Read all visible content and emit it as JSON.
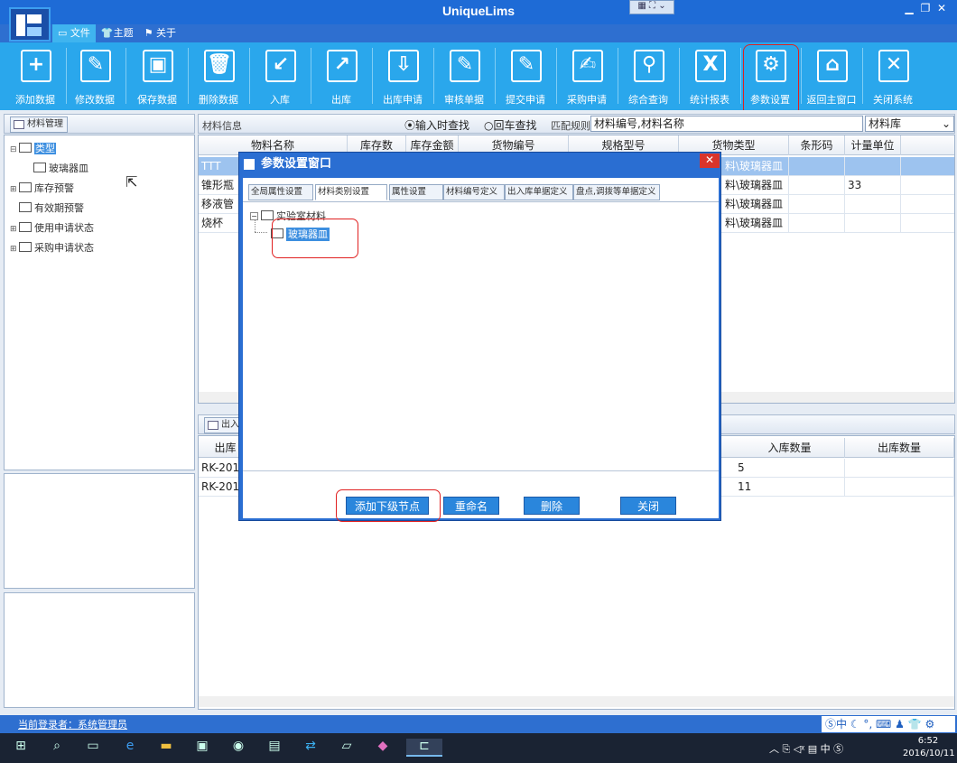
{
  "app": {
    "title": "UniqueLims"
  },
  "menu": [
    "文件",
    "主题",
    "关于"
  ],
  "toolbar": [
    {
      "label": "添加数据",
      "icon": "add-document-icon"
    },
    {
      "label": "修改数据",
      "icon": "edit-document-icon"
    },
    {
      "label": "保存数据",
      "icon": "save-icon"
    },
    {
      "label": "删除数据",
      "icon": "trash-icon"
    },
    {
      "label": "入库",
      "icon": "import-icon"
    },
    {
      "label": "出库",
      "icon": "export-icon"
    },
    {
      "label": "出库申请",
      "icon": "download-doc-icon"
    },
    {
      "label": "审核单据",
      "icon": "pen-icon"
    },
    {
      "label": "提交申请",
      "icon": "submit-doc-icon"
    },
    {
      "label": "采购申请",
      "icon": "purchase-icon"
    },
    {
      "label": "综合查询",
      "icon": "search-icon"
    },
    {
      "label": "统计报表",
      "icon": "excel-icon"
    },
    {
      "label": "参数设置",
      "icon": "gear-icon"
    },
    {
      "label": "返回主窗口",
      "icon": "home-icon"
    },
    {
      "label": "关闭系统",
      "icon": "close-x-icon"
    }
  ],
  "left_panel": {
    "tab": "材料管理",
    "tree": [
      {
        "label": "类型",
        "level": 0,
        "expander": "⊟",
        "selected": true
      },
      {
        "label": "玻璃器皿",
        "level": 1
      },
      {
        "label": "库存预警",
        "level": 0,
        "expander": "⊞"
      },
      {
        "label": "有效期预警",
        "level": 0,
        "expander": ""
      },
      {
        "label": "使用申请状态",
        "level": 0,
        "expander": "⊞"
      },
      {
        "label": "采购申请状态",
        "level": 0,
        "expander": "⊞"
      }
    ]
  },
  "material_info": {
    "title": "材料信息",
    "radio_live": "输入时查找",
    "radio_enter": "回车查找",
    "match_rule_label": "匹配规则",
    "search_value": "材料编号,材料名称",
    "library_select": "材料库",
    "columns": [
      "物料名称",
      "库存数",
      "库存金额",
      "货物编号",
      "规格型号",
      "货物类型",
      "条形码",
      "计量单位"
    ],
    "rows": [
      {
        "name": "TTT",
        "type": "料\\玻璃器皿",
        "barcode": "",
        "unit": "",
        "selected": true
      },
      {
        "name": "锥形瓶",
        "type": "料\\玻璃器皿",
        "barcode": "",
        "unit": "33"
      },
      {
        "name": "移液管",
        "type": "料\\玻璃器皿",
        "barcode": "",
        "unit": ""
      },
      {
        "name": "烧杯",
        "type": "料\\玻璃器皿",
        "barcode": "",
        "unit": ""
      }
    ]
  },
  "inout": {
    "tab": "出入",
    "columns": [
      "出库",
      "入库数量",
      "出库数量"
    ],
    "rows": [
      {
        "code": "RK-201",
        "in_qty": "5",
        "out_qty": ""
      },
      {
        "code": "RK-201",
        "in_qty": "11",
        "out_qty": ""
      }
    ]
  },
  "dialog": {
    "title": "参数设置窗口",
    "tabs": [
      "全局属性设置",
      "材料类别设置",
      "属性设置",
      "材料编号定义",
      "出入库单据定义",
      "盘点,调拨等单据定义"
    ],
    "active_tab": 1,
    "tree_root": "实验室材料",
    "tree_child": "玻璃器皿",
    "buttons": {
      "add_child": "添加下级节点",
      "rename": "重命名",
      "delete": "删除",
      "close": "关闭"
    }
  },
  "status": {
    "login_text": "当前登录者：系统管理员"
  },
  "taskbar": {
    "time": "6:52",
    "date": "2016/10/11",
    "ime": "中"
  },
  "colors": {
    "accent": "#2aa7ec",
    "title": "#1e6bd6",
    "highlight": "#e02020"
  }
}
